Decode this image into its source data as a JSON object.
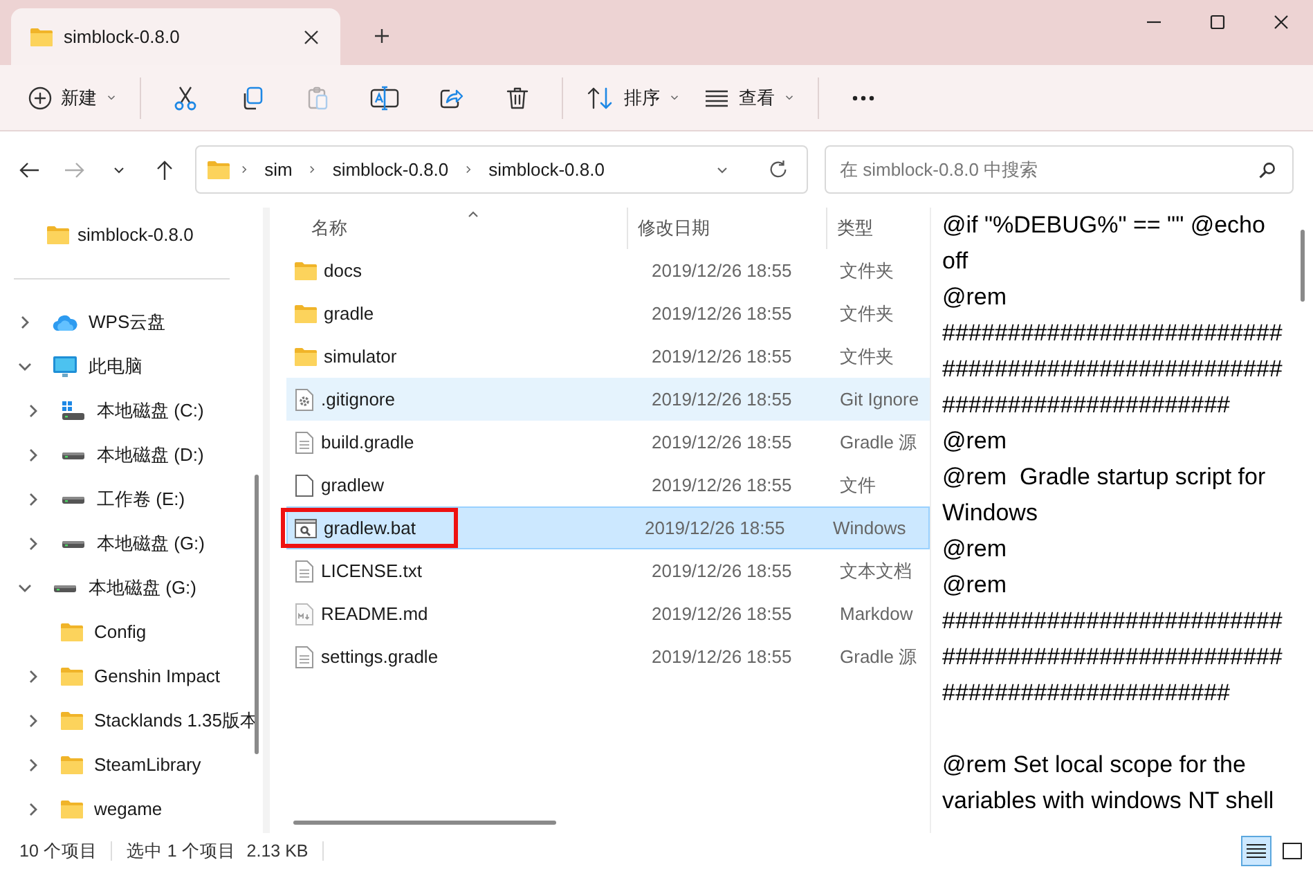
{
  "window": {
    "tab_title": "simblock-0.8.0"
  },
  "toolbar": [
    [
      {
        "kind": "new",
        "label": "新建",
        "dropdown": true,
        "disabled": false
      }
    ],
    [
      {
        "kind": "cut",
        "disabled": false
      },
      {
        "kind": "copy",
        "disabled": false
      },
      {
        "kind": "paste",
        "disabled": true
      },
      {
        "kind": "rename",
        "disabled": false
      },
      {
        "kind": "share",
        "disabled": false
      },
      {
        "kind": "delete",
        "disabled": false
      }
    ],
    [
      {
        "kind": "sort",
        "label": "排序",
        "dropdown": true,
        "disabled": false
      },
      {
        "kind": "view",
        "label": "查看",
        "dropdown": true,
        "disabled": false
      }
    ],
    [
      {
        "kind": "more",
        "disabled": false
      }
    ]
  ],
  "navigation": [
    {
      "kind": "back",
      "disabled": false
    },
    {
      "kind": "forward",
      "disabled": true
    },
    {
      "kind": "recent",
      "disabled": false
    },
    {
      "kind": "up",
      "disabled": false
    }
  ],
  "address": {
    "crumbs": [
      "sim",
      "simblock-0.8.0",
      "simblock-0.8.0"
    ]
  },
  "search": {
    "placeholder": "在 simblock-0.8.0 中搜索"
  },
  "sidebar": {
    "pinned": [
      {
        "label": "simblock-0.8.0",
        "kind": "folder"
      }
    ],
    "tree": [
      {
        "label": "WPS云盘",
        "kind": "cloud",
        "expanded": false
      },
      {
        "label": "此电脑",
        "kind": "pc",
        "expanded": true,
        "children": [
          {
            "label": "本地磁盘 (C:)",
            "kind": "system-drive",
            "expanded": false
          },
          {
            "label": "本地磁盘 (D:)",
            "kind": "drive",
            "expanded": false
          },
          {
            "label": "工作卷 (E:)",
            "kind": "drive",
            "expanded": false
          },
          {
            "label": "本地磁盘 (G:)",
            "kind": "drive",
            "expanded": false
          }
        ]
      },
      {
        "label": "本地磁盘 (G:)",
        "kind": "drive",
        "expanded": true,
        "children": [
          {
            "label": "Config",
            "kind": "folder"
          },
          {
            "label": "Genshin Impact",
            "kind": "folder",
            "expanded": false
          },
          {
            "label": "Stacklands 1.35版本",
            "kind": "folder",
            "expanded": false
          },
          {
            "label": "SteamLibrary",
            "kind": "folder",
            "expanded": false
          },
          {
            "label": "wegame",
            "kind": "folder",
            "expanded": false
          }
        ]
      }
    ]
  },
  "files": {
    "columns": [
      {
        "label": "名称",
        "sorted": true
      },
      {
        "label": "修改日期",
        "sorted": false
      },
      {
        "label": "类型",
        "sorted": false
      }
    ],
    "rows": [
      {
        "name": "docs",
        "date": "2019/12/26 18:55",
        "type": "文件夹",
        "kind": "folder",
        "selected": false,
        "hovered": false,
        "outlined": false
      },
      {
        "name": "gradle",
        "date": "2019/12/26 18:55",
        "type": "文件夹",
        "kind": "folder",
        "selected": false,
        "hovered": false,
        "outlined": false
      },
      {
        "name": "simulator",
        "date": "2019/12/26 18:55",
        "type": "文件夹",
        "kind": "folder",
        "selected": false,
        "hovered": false,
        "outlined": false
      },
      {
        "name": ".gitignore",
        "date": "2019/12/26 18:55",
        "type": "Git Ignore",
        "kind": "settings-file",
        "selected": false,
        "hovered": true,
        "outlined": false
      },
      {
        "name": "build.gradle",
        "date": "2019/12/26 18:55",
        "type": "Gradle 源",
        "kind": "text-file",
        "selected": false,
        "hovered": false,
        "outlined": false
      },
      {
        "name": "gradlew",
        "date": "2019/12/26 18:55",
        "type": "文件",
        "kind": "blank-file",
        "selected": false,
        "hovered": false,
        "outlined": false
      },
      {
        "name": "gradlew.bat",
        "date": "2019/12/26 18:55",
        "type": "Windows",
        "kind": "batch-file",
        "selected": true,
        "hovered": false,
        "outlined": true
      },
      {
        "name": "LICENSE.txt",
        "date": "2019/12/26 18:55",
        "type": "文本文档",
        "kind": "text-file",
        "selected": false,
        "hovered": false,
        "outlined": false
      },
      {
        "name": "README.md",
        "date": "2019/12/26 18:55",
        "type": "Markdow",
        "kind": "markdown-file",
        "selected": false,
        "hovered": false,
        "outlined": false
      },
      {
        "name": "settings.gradle",
        "date": "2019/12/26 18:55",
        "type": "Gradle 源",
        "kind": "text-file",
        "selected": false,
        "hovered": false,
        "outlined": false
      }
    ]
  },
  "preview": {
    "blocks": [
      {
        "lines": [
          "@if \"%DEBUG%\" == \"\" @echo off",
          "@rem",
          "##########################################################################",
          "@rem",
          "@rem  Gradle startup script for Windows",
          "@rem",
          "@rem",
          "##########################################################################"
        ]
      },
      {
        "lines": [
          "@rem Set local scope for the variables with windows NT shell"
        ]
      }
    ]
  },
  "status_bar": {
    "item_count": "10 个项目",
    "selection": "选中 1 个项目",
    "size": "2.13 KB",
    "view_modes": [
      {
        "kind": "details",
        "selected": true
      },
      {
        "kind": "tiles",
        "selected": false
      }
    ]
  }
}
